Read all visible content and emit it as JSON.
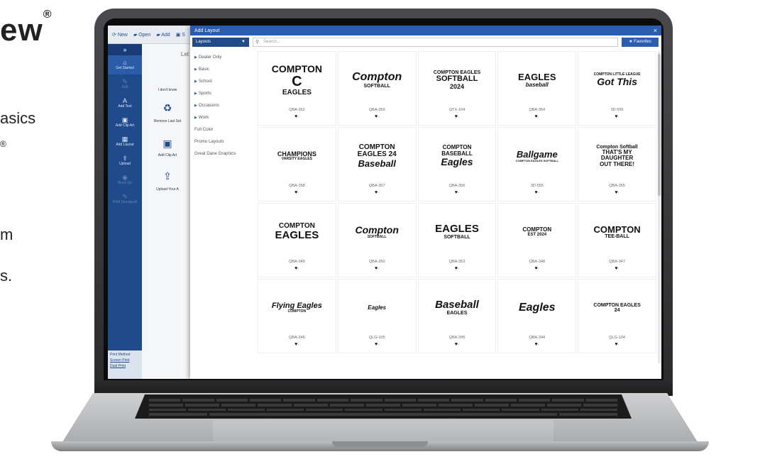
{
  "background": {
    "brand": "ew",
    "brand_mark": "®",
    "line1": "asics",
    "sup_mark": "®",
    "line2": "m",
    "line3": "s."
  },
  "toolbar": {
    "new": "New",
    "open": "Open",
    "add": "Add",
    "more": "S"
  },
  "sidebar": {
    "collapse": "»",
    "items": [
      {
        "label": "Get Started"
      },
      {
        "label": "Edit"
      },
      {
        "label": "Add Text"
      },
      {
        "label": "Add Clip Art"
      },
      {
        "label": "Add Layout"
      },
      {
        "label": "Upload"
      },
      {
        "label": "Mock Up"
      },
      {
        "label": "Print Standards"
      }
    ],
    "print_method": {
      "title": "Print Method",
      "opt1": "Screen Print",
      "opt2": "Dual Print"
    }
  },
  "under_panel": {
    "heading": "Let",
    "q": "I don't know",
    "remove": "Remove Last Set",
    "add_clip": "Add Clip Art",
    "upload": "Upload Your A"
  },
  "modal": {
    "title": "Add Layout",
    "close": "×",
    "dropdown": "Layouts",
    "search_placeholder": "Search...",
    "favorites": "Favorites",
    "categories": [
      {
        "label": "Dealer Only",
        "arrow": true
      },
      {
        "label": "Basic",
        "arrow": true
      },
      {
        "label": "School",
        "arrow": true
      },
      {
        "label": "Sports",
        "arrow": true
      },
      {
        "label": "Occasions",
        "arrow": true
      },
      {
        "label": "Work",
        "arrow": true
      },
      {
        "label": "Full Color",
        "arrow": false
      },
      {
        "label": "Promo Layouts",
        "arrow": false
      },
      {
        "label": "Great Dane Graphics",
        "arrow": false
      }
    ],
    "items": [
      {
        "code": "QBA-362",
        "art": "COMPTON|C|EAGLES"
      },
      {
        "code": "QBA-359",
        "art": "Compton|SOFTBALL"
      },
      {
        "code": "QTX-104",
        "art": "COMPTON EAGLES|SOFTBALL|2024"
      },
      {
        "code": "QBA-354",
        "art": "EAGLES|baseball"
      },
      {
        "code": "3D-556",
        "art": "COMPTON LITTLE LEAGUE|Got This"
      },
      {
        "code": "QBA-358",
        "art": "CHAMPIONS|VARSITY EAGLES"
      },
      {
        "code": "QBA-357",
        "art": "COMPTON|EAGLES 24|Baseball"
      },
      {
        "code": "QBA-356",
        "art": "COMPTON BASEBALL|Eagles"
      },
      {
        "code": "3D-555",
        "art": "Ballgame|COMPTON EAGLES SOFTBALL"
      },
      {
        "code": "QBA-355",
        "art": "Compton Softball|THAT'S MY|DAUGHTER|OUT THERE!"
      },
      {
        "code": "QBA-349",
        "art": "COMPTON|EAGLES"
      },
      {
        "code": "QBA-350",
        "art": "Compton|SOFTBALL"
      },
      {
        "code": "QBA-353",
        "art": "EAGLES|SOFTBALL"
      },
      {
        "code": "QBA-348",
        "art": "COMPTON|EST 2024"
      },
      {
        "code": "QBA-347",
        "art": "COMPTON|TEE-BALL"
      },
      {
        "code": "QBA-346",
        "art": "Flying Eagles|COMPTON"
      },
      {
        "code": "QLG-105",
        "art": "Eagles"
      },
      {
        "code": "QBA-345",
        "art": "Baseball|EAGLES"
      },
      {
        "code": "QBA-344",
        "art": "Eagles"
      },
      {
        "code": "QLG-104",
        "art": "COMPTON EAGLES 24"
      }
    ]
  }
}
